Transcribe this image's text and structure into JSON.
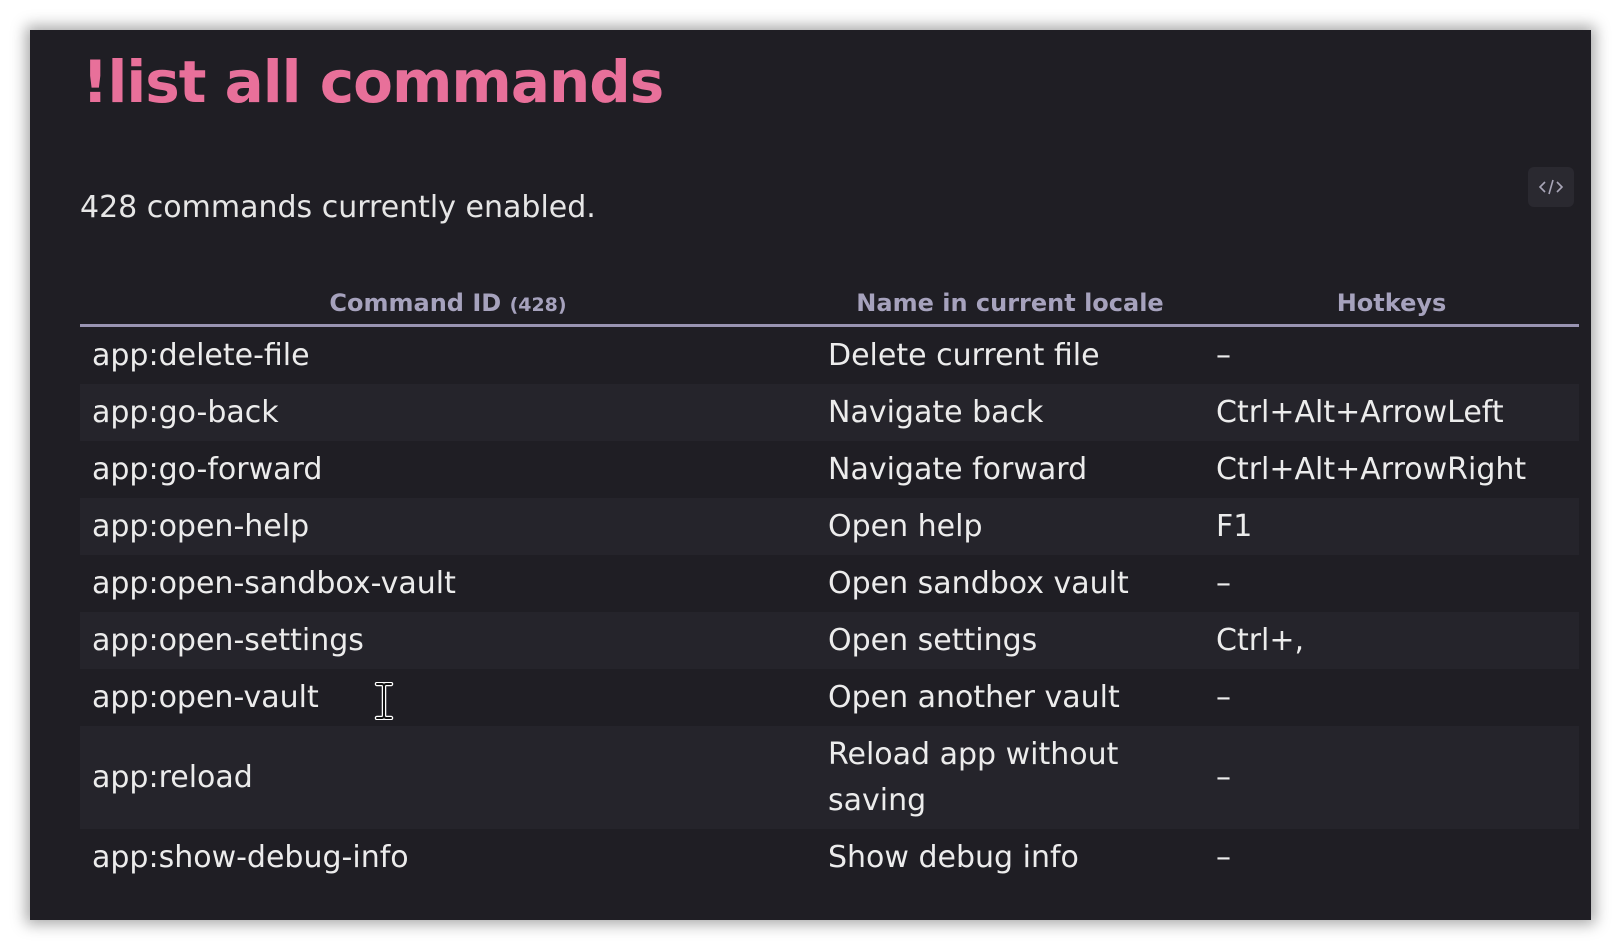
{
  "page": {
    "title": "!list all commands",
    "summary": "428 commands currently enabled.",
    "code_button_icon": "code-icon"
  },
  "colors": {
    "background": "#1f1e24",
    "row_alt": "#25242b",
    "title": "#e8709a",
    "header_text": "#a6a2bd"
  },
  "table": {
    "headers": {
      "command_id": "Command ID",
      "command_id_count": "(428)",
      "name": "Name in current locale",
      "hotkeys": "Hotkeys"
    },
    "rows": [
      {
        "id": "app:delete-file",
        "name": "Delete current file",
        "hotkey": "–"
      },
      {
        "id": "app:go-back",
        "name": "Navigate back",
        "hotkey": "Ctrl+Alt+ArrowLeft"
      },
      {
        "id": "app:go-forward",
        "name": "Navigate forward",
        "hotkey": "Ctrl+Alt+ArrowRight"
      },
      {
        "id": "app:open-help",
        "name": "Open help",
        "hotkey": "F1"
      },
      {
        "id": "app:open-sandbox-vault",
        "name": "Open sandbox vault",
        "hotkey": "–"
      },
      {
        "id": "app:open-settings",
        "name": "Open settings",
        "hotkey": "Ctrl+,"
      },
      {
        "id": "app:open-vault",
        "name": "Open another vault",
        "hotkey": "–"
      },
      {
        "id": "app:reload",
        "name": "Reload app without saving",
        "hotkey": "–"
      },
      {
        "id": "app:show-debug-info",
        "name": "Show debug info",
        "hotkey": "–"
      }
    ]
  }
}
